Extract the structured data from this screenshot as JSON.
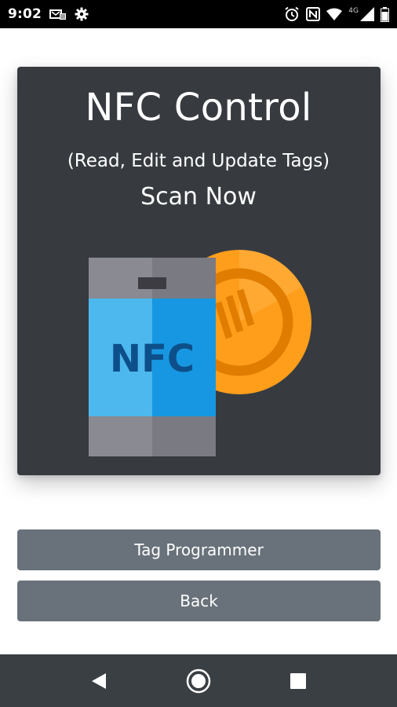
{
  "status_bar": {
    "time": "9:02",
    "left_icons": [
      "sync-icon",
      "gear-icon"
    ],
    "right_icons": [
      "alarm-icon",
      "nfc-icon",
      "wifi-icon",
      "signal-icon",
      "battery-icon"
    ],
    "network_label": "4G"
  },
  "card": {
    "title": "NFC Control",
    "subtitle": "(Read, Edit and Update Tags)",
    "prompt": "Scan Now",
    "illustration": {
      "phone_label": "NFC",
      "colors": {
        "card_bg": "#373b40",
        "phone_body": "#818087",
        "phone_screen": "#4db8ee",
        "tag": "#ff9e1b",
        "nfc_text": "#0d4f8a"
      }
    }
  },
  "buttons": {
    "tag_programmer": "Tag Programmer",
    "back": "Back"
  },
  "nav_bar": {
    "icons": [
      "back-triangle-icon",
      "home-circle-icon",
      "recents-square-icon"
    ]
  }
}
